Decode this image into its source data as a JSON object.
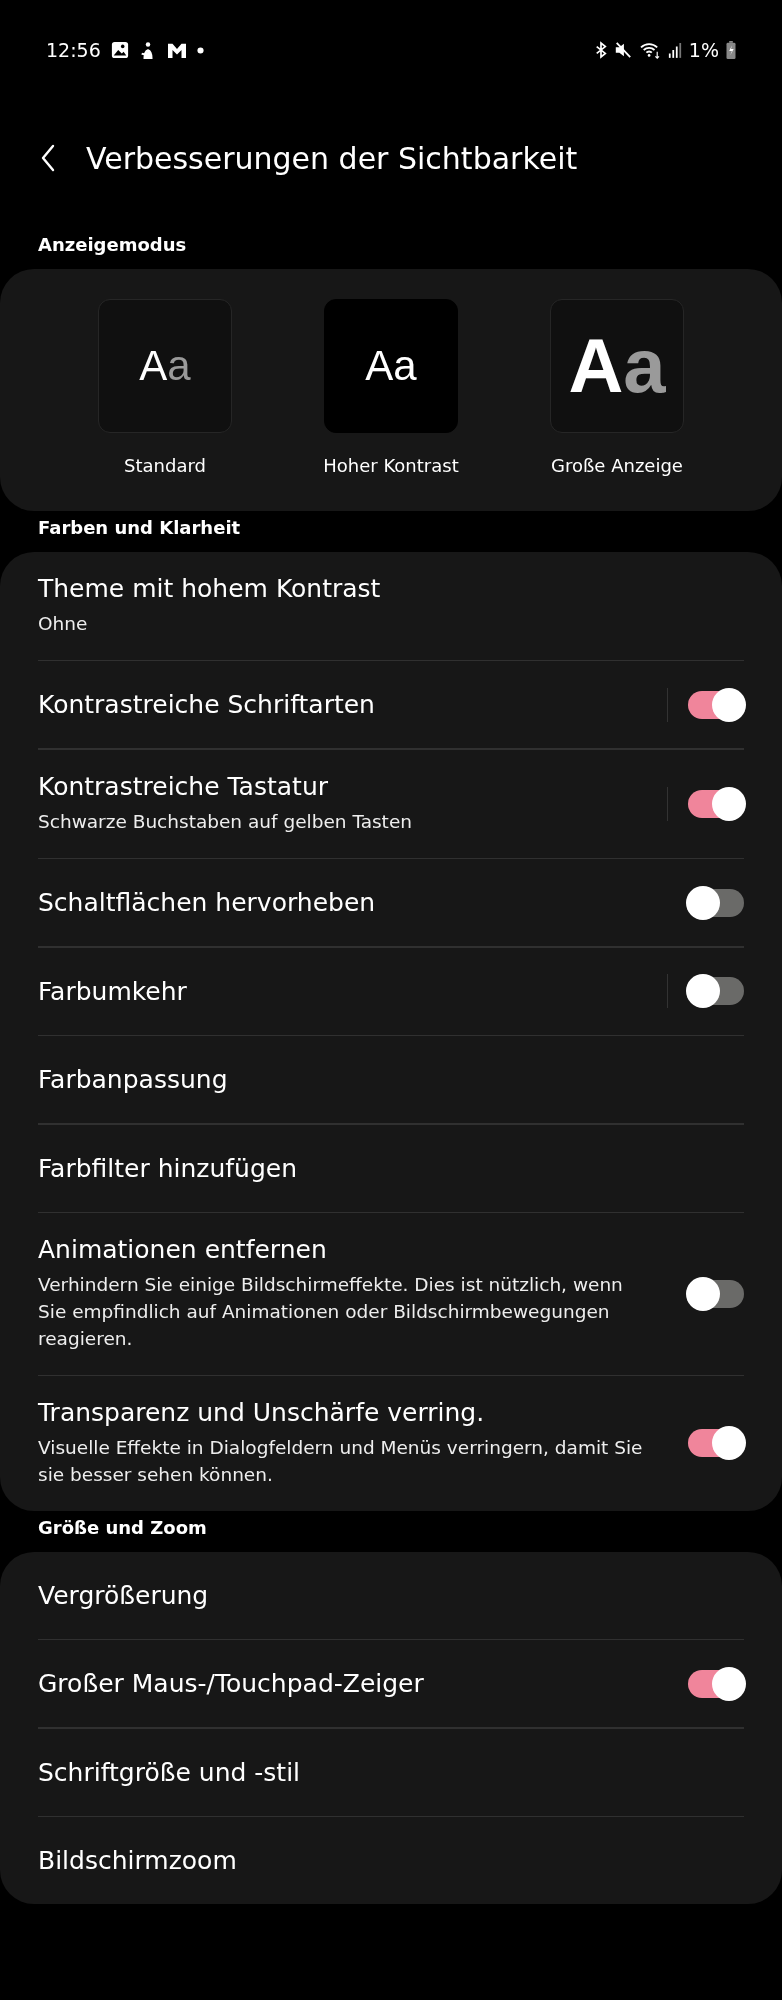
{
  "status_bar": {
    "time": "12:56",
    "battery": "1%"
  },
  "header": {
    "title": "Verbesserungen der Sichtbarkeit"
  },
  "sections": [
    {
      "title": "Anzeigemodus",
      "kind": "modes",
      "modes": [
        {
          "kind": "standard",
          "big": "A",
          "small": "a",
          "label": "Standard"
        },
        {
          "kind": "contrast",
          "big": "A",
          "small": "a",
          "label": "Hoher Kontrast"
        },
        {
          "kind": "large",
          "big": "A",
          "small": "a",
          "label": "Große Anzeige"
        }
      ]
    },
    {
      "title": "Farben und Klarheit",
      "kind": "list",
      "items": [
        {
          "kind": "link",
          "title": "Theme mit hohem Kontrast",
          "subtitle": "Ohne"
        },
        {
          "kind": "toggle",
          "title": "Kontrastreiche Schriftarten",
          "on": true,
          "divider": true
        },
        {
          "kind": "toggle",
          "title": "Kontrastreiche Tastatur",
          "subtitle": "Schwarze Buchstaben auf gelben Tasten",
          "on": true,
          "divider": true
        },
        {
          "kind": "toggle",
          "title": "Schaltflächen hervorheben",
          "on": false,
          "divider": false
        },
        {
          "kind": "toggle",
          "title": "Farbumkehr",
          "on": false,
          "divider": true
        },
        {
          "kind": "link",
          "title": "Farbanpassung"
        },
        {
          "kind": "link",
          "title": "Farbfilter hinzufügen"
        },
        {
          "kind": "toggle",
          "title": "Animationen entfernen",
          "subtitle": "Verhindern Sie einige Bildschirmeffekte. Dies ist nützlich, wenn Sie empfindlich auf Animationen oder Bildschirmbewegungen reagieren.",
          "on": false,
          "divider": false
        },
        {
          "kind": "toggle",
          "title": "Transparenz und Unschärfe verring.",
          "subtitle": "Visuelle Effekte in Dialogfeldern und Menüs verringern, damit Sie sie besser sehen können.",
          "on": true,
          "divider": false
        }
      ]
    },
    {
      "title": "Größe und Zoom",
      "kind": "list",
      "items": [
        {
          "kind": "link",
          "title": "Vergrößerung"
        },
        {
          "kind": "toggle",
          "title": "Großer Maus-/Touchpad-Zeiger",
          "on": true,
          "divider": false
        },
        {
          "kind": "link",
          "title": "Schriftgröße und -stil"
        },
        {
          "kind": "link",
          "title": "Bildschirmzoom"
        }
      ]
    }
  ]
}
